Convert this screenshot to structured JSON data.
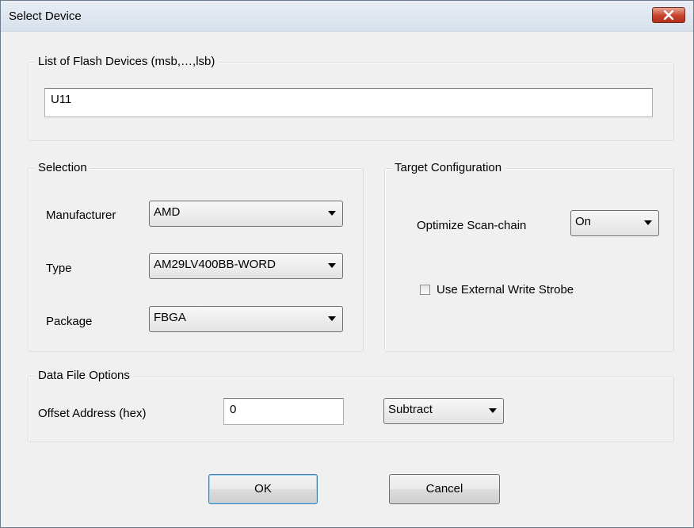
{
  "window": {
    "title": "Select Device",
    "close_icon": "close-icon"
  },
  "flash_devices": {
    "legend": "List of Flash Devices (msb,…,lsb)",
    "value": "U11"
  },
  "selection": {
    "legend": "Selection",
    "manufacturer_label": "Manufacturer",
    "manufacturer_value": "AMD",
    "type_label": "Type",
    "type_value": "AM29LV400BB-WORD",
    "package_label": "Package",
    "package_value": "FBGA"
  },
  "target_config": {
    "legend": "Target Configuration",
    "optimize_label": "Optimize Scan-chain",
    "optimize_value": "On",
    "external_strobe_label": "Use External Write Strobe",
    "external_strobe_checked": false
  },
  "data_file": {
    "legend": "Data File Options",
    "offset_label": "Offset Address (hex)",
    "offset_value": "0",
    "operation_value": "Subtract"
  },
  "buttons": {
    "ok": "OK",
    "cancel": "Cancel"
  }
}
